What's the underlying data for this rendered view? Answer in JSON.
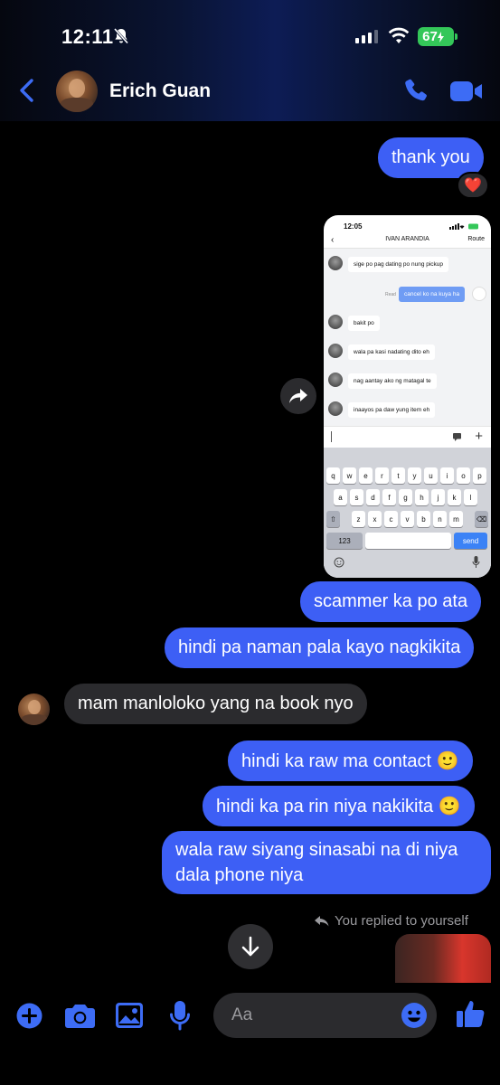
{
  "status_bar": {
    "time": "12:11",
    "battery": "67"
  },
  "header": {
    "contact_name": "Erich Guan"
  },
  "messages": [
    {
      "from": "me",
      "text": "thank you",
      "reaction": "❤️"
    },
    {
      "from": "me",
      "type": "image",
      "text": ""
    },
    {
      "from": "me",
      "text": "scammer ka po ata"
    },
    {
      "from": "me",
      "text": "hindi pa naman pala kayo nagkikita"
    },
    {
      "from": "them",
      "text": "mam manloloko yang na book nyo"
    },
    {
      "from": "me",
      "text": "hindi ka raw ma contact 🙂"
    },
    {
      "from": "me",
      "text": "hindi ka pa rin niya nakikita 🙂"
    },
    {
      "from": "me",
      "text": "wala raw siyang sinasabi na di niya dala phone niya"
    }
  ],
  "attachment": {
    "status_time": "12:05",
    "title": "IVAN ARANDIA",
    "route": "Route",
    "read_label": "Read",
    "chat": [
      {
        "from": "them",
        "text": "sige po pag dating po nung pickup"
      },
      {
        "from": "me",
        "text": "cancel ko na kuya ha"
      },
      {
        "from": "them",
        "text": "bakit po"
      },
      {
        "from": "them",
        "text": "wala pa kasi nadating dito eh"
      },
      {
        "from": "them",
        "text": "nag aantay ako ng matagal te"
      },
      {
        "from": "them",
        "text": "inaayos pa daw yung item eh"
      }
    ],
    "keyboard": {
      "row1": [
        "q",
        "w",
        "e",
        "r",
        "t",
        "y",
        "u",
        "i",
        "o",
        "p"
      ],
      "row2": [
        "a",
        "s",
        "d",
        "f",
        "g",
        "h",
        "j",
        "k",
        "l"
      ],
      "row3": [
        "z",
        "x",
        "c",
        "v",
        "b",
        "n",
        "m"
      ],
      "numbers_key": "123",
      "send_key": "send"
    }
  },
  "replied_note": "You replied to yourself",
  "composer": {
    "placeholder": "Aa"
  },
  "colors": {
    "outgoing_bubble": "#3d5ff5",
    "incoming_bubble": "#2b2b2e",
    "accent": "#3d6cf5"
  }
}
